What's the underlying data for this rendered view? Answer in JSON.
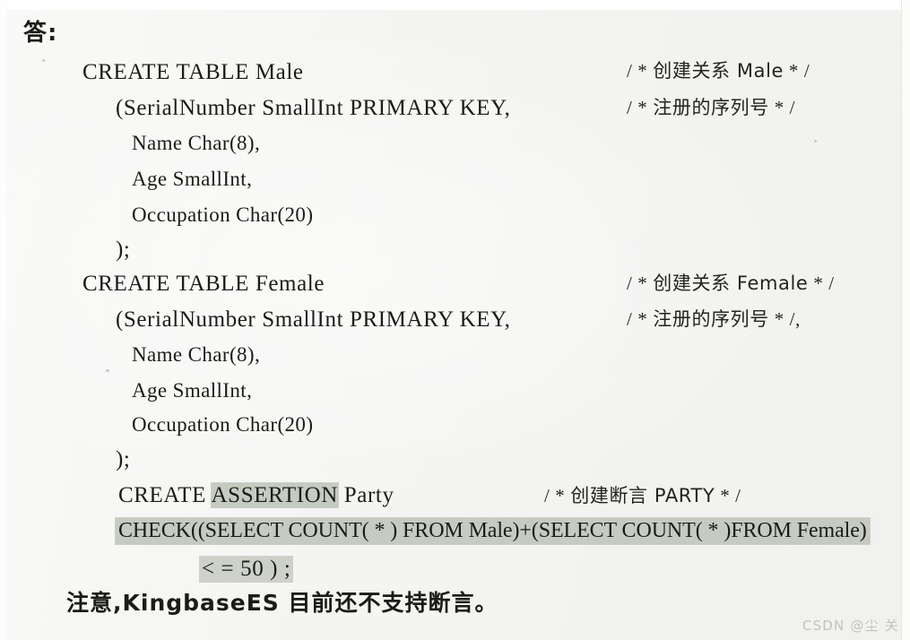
{
  "document": {
    "type": "scanned-textbook-page",
    "language": "zh-CN",
    "answer_label": "答:",
    "closing_note": "注意,KingbaseES 目前还不支持断言。",
    "watermark": "CSDN @尘 关"
  },
  "colors": {
    "page_background": "#f4f4f2",
    "ink": "#1b1b18",
    "highlight": "#c6cbc2",
    "watermark": "#c2c2c2"
  },
  "code_lines": [
    {
      "id": "l01",
      "text": "CREATE TABLE Male",
      "indent": 1,
      "highlight": "none"
    },
    {
      "id": "l02",
      "text": "(SerialNumber SmallInt PRIMARY KEY,",
      "indent": 2,
      "highlight": "none"
    },
    {
      "id": "l03",
      "text": "Name Char(8),",
      "indent": 3,
      "highlight": "none"
    },
    {
      "id": "l04",
      "text": "Age SmallInt,",
      "indent": 3,
      "highlight": "none"
    },
    {
      "id": "l05",
      "text": "Occupation Char(20)",
      "indent": 3,
      "highlight": "none"
    },
    {
      "id": "l06",
      "text": ");",
      "indent": 2,
      "highlight": "none"
    },
    {
      "id": "l07",
      "text": "CREATE TABLE Female",
      "indent": 1,
      "highlight": "none"
    },
    {
      "id": "l08",
      "text": "(SerialNumber SmallInt PRIMARY KEY,",
      "indent": 2,
      "highlight": "none"
    },
    {
      "id": "l09",
      "text": "Name Char(8),",
      "indent": 3,
      "highlight": "none"
    },
    {
      "id": "l10",
      "text": "Age SmallInt,",
      "indent": 3,
      "highlight": "none"
    },
    {
      "id": "l11",
      "text": "Occupation Char(20)",
      "indent": 3,
      "highlight": "none"
    },
    {
      "id": "l12",
      "text": ");",
      "indent": 2,
      "highlight": "none"
    },
    {
      "id": "l13a",
      "text": "CREATE ",
      "indent": 2,
      "highlight": "none"
    },
    {
      "id": "l13b",
      "text": "ASSERTION",
      "indent": 2,
      "highlight": "word"
    },
    {
      "id": "l13c",
      "text": " Party",
      "indent": 2,
      "highlight": "none"
    },
    {
      "id": "l14",
      "text": "CHECK((SELECT COUNT( * ) FROM Male)+(SELECT COUNT( * )FROM Female)",
      "indent": 2,
      "highlight": "full-line"
    },
    {
      "id": "l15",
      "text": "< = 50 ) ;",
      "indent": 4,
      "highlight": "full-line"
    }
  ],
  "comments": [
    {
      "id": "c01",
      "open": "/ * ",
      "text": "创建关系 Male",
      "close": " * /",
      "for_line": "l01"
    },
    {
      "id": "c02",
      "open": "/ * ",
      "text": "注册的序列号",
      "close": " * /",
      "for_line": "l02"
    },
    {
      "id": "c07",
      "open": "/ * ",
      "text": "创建关系 Female",
      "close": " * /",
      "for_line": "l07"
    },
    {
      "id": "c08",
      "open": "/ * ",
      "text": "注册的序列号",
      "close": " * /,",
      "for_line": "l08"
    },
    {
      "id": "c13",
      "open": "/ * ",
      "text": "创建断言 PARTY",
      "close": " * /",
      "for_line": "l13a"
    }
  ]
}
